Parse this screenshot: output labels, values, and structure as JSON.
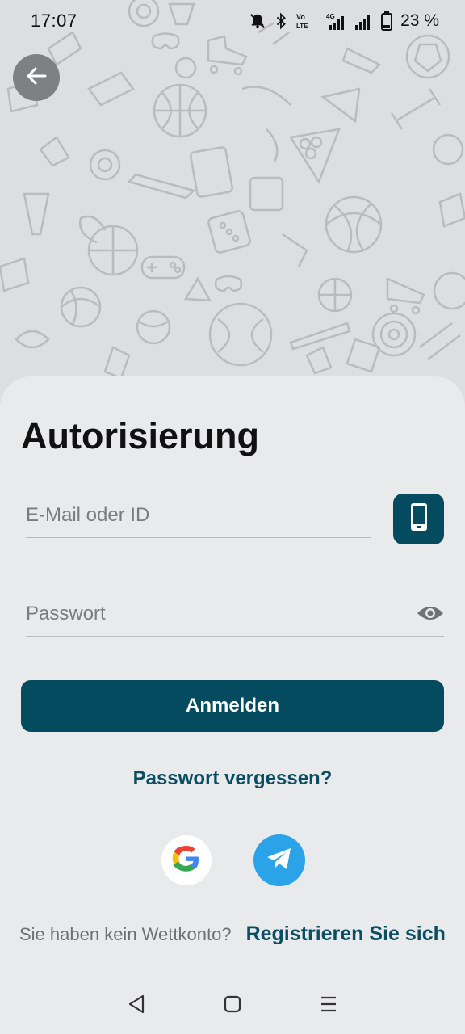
{
  "status": {
    "time": "17:07",
    "battery": "23 %",
    "icons": [
      "mute-bell-icon",
      "bluetooth-icon",
      "volte-icon",
      "signal-4g-icon",
      "signal-icon",
      "battery-icon"
    ]
  },
  "header": {
    "back_icon": "arrow-left-icon"
  },
  "form": {
    "title": "Autorisierung",
    "email_placeholder": "E-Mail oder ID",
    "password_placeholder": "Passwort",
    "login_label": "Anmelden",
    "forgot_label": "Passwort vergessen?"
  },
  "social": {
    "google_icon": "google-icon",
    "telegram_icon": "telegram-icon"
  },
  "register": {
    "question": "Sie haben kein Wettkonto?",
    "link": "Registrieren Sie sich"
  },
  "colors": {
    "primary": "#054b60",
    "link": "#0b4e63",
    "telegram": "#2aa3e8",
    "background": "#e9eaeb"
  }
}
